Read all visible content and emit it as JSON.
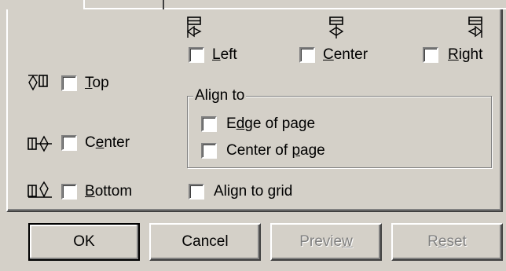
{
  "horizontal": {
    "left": {
      "pre": "",
      "key": "L",
      "post": "eft"
    },
    "center": {
      "pre": "",
      "key": "C",
      "post": "enter"
    },
    "right": {
      "pre": "",
      "key": "R",
      "post": "ight"
    }
  },
  "vertical": {
    "top": {
      "pre": "",
      "key": "T",
      "post": "op"
    },
    "center": {
      "pre": "C",
      "key": "e",
      "post": "nter"
    },
    "bottom": {
      "pre": "",
      "key": "B",
      "post": "ottom"
    }
  },
  "align_to": {
    "legend": "Align to",
    "edge_of_page": {
      "pre": "E",
      "key": "d",
      "post": "ge of page"
    },
    "center_of_page": {
      "pre": "Center of ",
      "key": "p",
      "post": "age"
    }
  },
  "align_to_grid": {
    "pre": "Align to ",
    "key": "g",
    "post": "rid"
  },
  "buttons": {
    "ok": "OK",
    "cancel": "Cancel",
    "preview": {
      "pre": "Previe",
      "key": "w",
      "post": ""
    },
    "reset": {
      "pre": "R",
      "key": "e",
      "post": "set"
    }
  },
  "icons": {
    "align_left": "align-left-icon",
    "align_center_h": "align-center-horizontal-icon",
    "align_right": "align-right-icon",
    "align_top": "align-top-icon",
    "align_center_v": "align-center-vertical-icon",
    "align_bottom": "align-bottom-icon"
  },
  "colors": {
    "face": "#d4d0c8",
    "shadow": "#808080",
    "dark": "#404040",
    "highlight": "#ffffff"
  }
}
